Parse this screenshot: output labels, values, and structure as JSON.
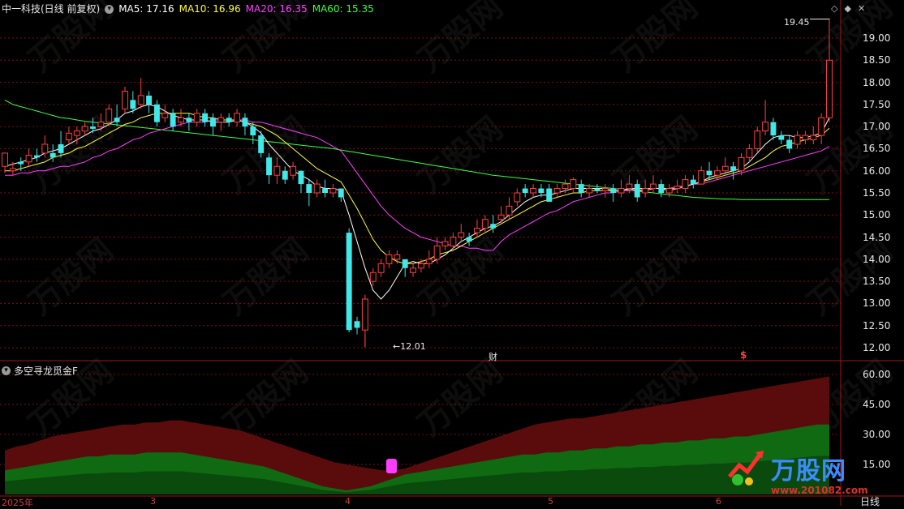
{
  "header": {
    "title": "中一科技(日线 前复权)",
    "ma5_label": "MA5: 17.16",
    "ma10_label": "MA10: 16.96",
    "ma20_label": "MA20: 16.35",
    "ma60_label": "MA60: 15.35"
  },
  "colors": {
    "ma5": "#ffffff",
    "ma10": "#ffff40",
    "ma20": "#ff40ff",
    "ma60": "#40ff40",
    "up": "#ff4040",
    "down": "#40e8e8",
    "grid": "#7a1010",
    "axis_text": "#e8e8e8"
  },
  "price_axis": [
    "19.00",
    "18.50",
    "18.00",
    "17.50",
    "17.00",
    "16.50",
    "16.00",
    "15.50",
    "15.00",
    "14.50",
    "14.00",
    "13.50",
    "13.00",
    "12.50",
    "12.00"
  ],
  "indicator_axis": [
    "60.00",
    "45.00",
    "30.00",
    "15.00"
  ],
  "annotations": {
    "high": "19.45",
    "low": "←12.01",
    "cai": "财",
    "dollar": "$"
  },
  "indicator": {
    "name": "多空寻龙觅金F"
  },
  "time_axis": [
    {
      "label": "2025年"
    },
    {
      "label": "3"
    },
    {
      "label": "4"
    },
    {
      "label": "5"
    },
    {
      "label": "6"
    }
  ],
  "period_label": "日线",
  "brand": {
    "name": "万股网",
    "url": "www.201082.com"
  },
  "window_icons": [
    "diamond-icon",
    "restore-icon",
    "close-icon"
  ],
  "chart_data": {
    "type": "candlestick",
    "ma_values": {
      "MA5": 17.16,
      "MA10": 16.96,
      "MA20": 16.35,
      "MA60": 15.35
    },
    "ylim": [
      11.9,
      19.5
    ],
    "high_marker": 19.45,
    "low_marker": 12.01,
    "candles": [
      [
        16.1,
        16.4,
        16.25,
        15.95
      ],
      [
        16.0,
        16.05,
        16.2,
        15.9
      ],
      [
        16.2,
        16.15,
        16.3,
        16.0
      ],
      [
        16.2,
        16.35,
        16.5,
        16.1
      ],
      [
        16.35,
        16.3,
        16.5,
        16.2
      ],
      [
        16.4,
        16.6,
        16.8,
        16.3
      ],
      [
        16.4,
        16.3,
        16.6,
        16.2
      ],
      [
        16.6,
        16.4,
        16.9,
        16.3
      ],
      [
        16.7,
        16.85,
        17.0,
        16.6
      ],
      [
        16.8,
        16.9,
        17.0,
        16.6
      ],
      [
        16.9,
        17.0,
        17.1,
        16.8
      ],
      [
        17.0,
        16.95,
        17.2,
        16.85
      ],
      [
        17.0,
        17.1,
        17.3,
        16.9
      ],
      [
        17.1,
        17.4,
        17.5,
        17.0
      ],
      [
        17.2,
        17.1,
        17.5,
        17.0
      ],
      [
        17.4,
        17.8,
        17.9,
        17.3
      ],
      [
        17.6,
        17.4,
        17.8,
        17.3
      ],
      [
        17.5,
        17.7,
        18.1,
        17.4
      ],
      [
        17.7,
        17.5,
        17.8,
        17.3
      ],
      [
        17.5,
        17.1,
        17.6,
        17.0
      ],
      [
        17.2,
        17.3,
        17.5,
        17.1
      ],
      [
        17.3,
        17.0,
        17.4,
        16.9
      ],
      [
        17.1,
        17.2,
        17.4,
        17.0
      ],
      [
        17.2,
        17.1,
        17.3,
        16.9
      ],
      [
        17.1,
        17.3,
        17.4,
        17.0
      ],
      [
        17.3,
        17.1,
        17.4,
        17.0
      ],
      [
        17.2,
        17.0,
        17.3,
        16.8
      ],
      [
        17.1,
        17.2,
        17.3,
        16.9
      ],
      [
        17.2,
        17.1,
        17.3,
        17.0
      ],
      [
        17.1,
        17.3,
        17.4,
        17.0
      ],
      [
        17.2,
        17.0,
        17.3,
        16.8
      ],
      [
        17.0,
        16.8,
        17.1,
        16.6
      ],
      [
        16.8,
        16.4,
        16.9,
        16.3
      ],
      [
        16.3,
        15.9,
        16.4,
        15.7
      ],
      [
        15.9,
        16.1,
        16.3,
        15.7
      ],
      [
        16.0,
        15.8,
        16.1,
        15.7
      ],
      [
        15.9,
        16.1,
        16.2,
        15.8
      ],
      [
        16.0,
        15.7,
        16.0,
        15.5
      ],
      [
        15.7,
        15.5,
        15.8,
        15.2
      ],
      [
        15.5,
        15.7,
        15.8,
        15.4
      ],
      [
        15.6,
        15.5,
        15.8,
        15.4
      ],
      [
        15.5,
        15.6,
        15.7,
        15.4
      ],
      [
        15.6,
        15.4,
        15.6,
        15.3
      ],
      [
        14.6,
        12.4,
        14.7,
        12.35
      ],
      [
        12.6,
        12.45,
        12.7,
        12.3
      ],
      [
        12.4,
        13.1,
        13.2,
        12.01
      ],
      [
        13.5,
        13.7,
        13.8,
        13.4
      ],
      [
        13.7,
        13.9,
        14.0,
        13.6
      ],
      [
        13.9,
        14.1,
        14.2,
        13.8
      ],
      [
        14.0,
        14.1,
        14.2,
        13.9
      ],
      [
        14.0,
        13.8,
        14.0,
        13.6
      ],
      [
        13.7,
        13.8,
        13.9,
        13.6
      ],
      [
        13.8,
        13.9,
        14.0,
        13.7
      ],
      [
        13.9,
        14.0,
        14.2,
        13.8
      ],
      [
        14.0,
        14.3,
        14.5,
        13.9
      ],
      [
        14.3,
        14.4,
        14.5,
        14.2
      ],
      [
        14.3,
        14.5,
        14.6,
        14.2
      ],
      [
        14.5,
        14.6,
        14.8,
        14.4
      ],
      [
        14.5,
        14.4,
        14.6,
        14.3
      ],
      [
        14.6,
        14.7,
        14.9,
        14.5
      ],
      [
        14.7,
        14.9,
        15.0,
        14.6
      ],
      [
        14.8,
        14.7,
        15.0,
        14.6
      ],
      [
        14.9,
        15.0,
        15.2,
        14.8
      ],
      [
        15.0,
        15.2,
        15.4,
        14.9
      ],
      [
        15.3,
        15.5,
        15.6,
        15.2
      ],
      [
        15.6,
        15.5,
        15.7,
        15.4
      ],
      [
        15.5,
        15.6,
        15.7,
        15.4
      ],
      [
        15.6,
        15.5,
        15.7,
        15.4
      ],
      [
        15.6,
        15.3,
        15.7,
        15.3
      ],
      [
        15.5,
        15.6,
        15.7,
        15.4
      ],
      [
        15.6,
        15.7,
        15.8,
        15.5
      ],
      [
        15.6,
        15.8,
        15.85,
        15.5
      ],
      [
        15.7,
        15.5,
        15.8,
        15.4
      ],
      [
        15.5,
        15.6,
        15.7,
        15.4
      ],
      [
        15.6,
        15.55,
        15.7,
        15.5
      ],
      [
        15.55,
        15.6,
        15.7,
        15.4
      ],
      [
        15.6,
        15.5,
        15.7,
        15.3
      ],
      [
        15.5,
        15.6,
        15.8,
        15.4
      ],
      [
        15.6,
        15.7,
        15.9,
        15.5
      ],
      [
        15.7,
        15.4,
        15.8,
        15.3
      ],
      [
        15.5,
        15.6,
        15.8,
        15.4
      ],
      [
        15.6,
        15.7,
        15.9,
        15.5
      ],
      [
        15.7,
        15.5,
        15.8,
        15.4
      ],
      [
        15.5,
        15.6,
        15.7,
        15.4
      ],
      [
        15.6,
        15.65,
        15.8,
        15.5
      ],
      [
        15.6,
        15.8,
        15.9,
        15.5
      ],
      [
        15.8,
        15.7,
        15.9,
        15.6
      ],
      [
        15.7,
        16.0,
        16.1,
        15.7
      ],
      [
        16.0,
        15.9,
        16.2,
        15.8
      ],
      [
        15.9,
        16.0,
        16.1,
        15.8
      ],
      [
        16.0,
        16.1,
        16.3,
        15.9
      ],
      [
        16.1,
        16.0,
        16.2,
        15.8
      ],
      [
        16.0,
        16.3,
        16.4,
        15.9
      ],
      [
        16.3,
        16.5,
        16.6,
        16.2
      ],
      [
        16.5,
        16.9,
        17.0,
        16.4
      ],
      [
        16.9,
        17.1,
        17.6,
        16.8
      ],
      [
        17.1,
        16.8,
        17.2,
        16.7
      ],
      [
        16.8,
        16.7,
        16.9,
        16.6
      ],
      [
        16.7,
        16.5,
        16.8,
        16.4
      ],
      [
        16.6,
        16.8,
        16.9,
        16.5
      ],
      [
        16.7,
        16.8,
        16.9,
        16.6
      ],
      [
        16.7,
        16.8,
        17.0,
        16.6
      ],
      [
        16.8,
        17.2,
        17.3,
        16.6
      ],
      [
        17.2,
        18.5,
        19.45,
        17.1
      ]
    ],
    "ma5": [
      16.1,
      16.15,
      16.2,
      16.25,
      16.3,
      16.4,
      16.45,
      16.5,
      16.6,
      16.7,
      16.8,
      16.9,
      16.95,
      17.05,
      17.15,
      17.3,
      17.35,
      17.45,
      17.5,
      17.45,
      17.35,
      17.25,
      17.2,
      17.15,
      17.15,
      17.15,
      17.1,
      17.1,
      17.1,
      17.15,
      17.1,
      17.0,
      16.85,
      16.6,
      16.4,
      16.2,
      16.0,
      15.9,
      15.8,
      15.65,
      15.6,
      15.6,
      15.55,
      15.0,
      14.4,
      13.8,
      13.3,
      13.1,
      13.3,
      13.6,
      13.9,
      13.95,
      13.9,
      13.9,
      14.0,
      14.1,
      14.25,
      14.4,
      14.5,
      14.6,
      14.7,
      14.75,
      14.85,
      15.0,
      15.15,
      15.3,
      15.4,
      15.45,
      15.45,
      15.5,
      15.55,
      15.6,
      15.6,
      15.6,
      15.6,
      15.6,
      15.55,
      15.55,
      15.6,
      15.55,
      15.55,
      15.6,
      15.6,
      15.55,
      15.6,
      15.65,
      15.7,
      15.75,
      15.85,
      15.9,
      15.95,
      16.0,
      16.05,
      16.2,
      16.4,
      16.6,
      16.75,
      16.8,
      16.8,
      16.75,
      16.75,
      16.8,
      16.85,
      17.2
    ],
    "ma10": [
      16.0,
      16.0,
      16.05,
      16.1,
      16.15,
      16.2,
      16.3,
      16.35,
      16.4,
      16.5,
      16.55,
      16.65,
      16.75,
      16.85,
      16.95,
      17.05,
      17.1,
      17.2,
      17.25,
      17.3,
      17.3,
      17.3,
      17.3,
      17.3,
      17.25,
      17.2,
      17.2,
      17.15,
      17.15,
      17.15,
      17.1,
      17.05,
      17.0,
      16.9,
      16.8,
      16.65,
      16.5,
      16.35,
      16.2,
      16.05,
      15.95,
      15.85,
      15.75,
      15.45,
      15.15,
      14.8,
      14.45,
      14.2,
      14.05,
      13.95,
      13.9,
      13.9,
      13.95,
      14.0,
      14.1,
      14.15,
      14.2,
      14.3,
      14.4,
      14.5,
      14.6,
      14.7,
      14.8,
      14.9,
      15.0,
      15.1,
      15.2,
      15.3,
      15.35,
      15.4,
      15.45,
      15.5,
      15.5,
      15.55,
      15.55,
      15.55,
      15.55,
      15.55,
      15.6,
      15.6,
      15.6,
      15.6,
      15.6,
      15.6,
      15.6,
      15.65,
      15.7,
      15.75,
      15.8,
      15.85,
      15.9,
      15.95,
      16.0,
      16.1,
      16.2,
      16.3,
      16.45,
      16.55,
      16.6,
      16.65,
      16.7,
      16.75,
      16.8,
      16.96
    ],
    "ma20": [
      15.9,
      15.9,
      15.95,
      15.95,
      16.0,
      16.0,
      16.05,
      16.1,
      16.1,
      16.15,
      16.2,
      16.3,
      16.35,
      16.45,
      16.5,
      16.6,
      16.7,
      16.75,
      16.85,
      16.9,
      16.95,
      17.0,
      17.05,
      17.1,
      17.1,
      17.1,
      17.15,
      17.15,
      17.15,
      17.15,
      17.15,
      17.1,
      17.1,
      17.05,
      17.0,
      16.95,
      16.9,
      16.85,
      16.8,
      16.75,
      16.65,
      16.55,
      16.45,
      16.2,
      15.95,
      15.7,
      15.45,
      15.2,
      15.0,
      14.85,
      14.7,
      14.6,
      14.5,
      14.45,
      14.4,
      14.35,
      14.3,
      14.3,
      14.25,
      14.25,
      14.2,
      14.2,
      14.4,
      14.55,
      14.65,
      14.75,
      14.85,
      14.95,
      15.05,
      15.1,
      15.2,
      15.3,
      15.35,
      15.4,
      15.45,
      15.5,
      15.5,
      15.55,
      15.55,
      15.55,
      15.6,
      15.6,
      15.6,
      15.6,
      15.65,
      15.65,
      15.7,
      15.7,
      15.75,
      15.8,
      15.85,
      15.9,
      15.95,
      16.0,
      16.05,
      16.1,
      16.15,
      16.2,
      16.25,
      16.3,
      16.35,
      16.4,
      16.45,
      16.55
    ],
    "ma60": [
      17.6,
      17.5,
      17.45,
      17.4,
      17.35,
      17.3,
      17.25,
      17.2,
      17.18,
      17.15,
      17.12,
      17.1,
      17.08,
      17.06,
      17.04,
      17.02,
      17.0,
      16.98,
      16.96,
      16.94,
      16.92,
      16.9,
      16.88,
      16.86,
      16.84,
      16.82,
      16.8,
      16.78,
      16.76,
      16.74,
      16.72,
      16.7,
      16.68,
      16.66,
      16.64,
      16.62,
      16.6,
      16.58,
      16.56,
      16.54,
      16.52,
      16.5,
      16.47,
      16.44,
      16.41,
      16.38,
      16.35,
      16.32,
      16.29,
      16.26,
      16.23,
      16.2,
      16.17,
      16.14,
      16.11,
      16.08,
      16.05,
      16.02,
      15.99,
      15.96,
      15.93,
      15.9,
      15.88,
      15.86,
      15.84,
      15.82,
      15.8,
      15.78,
      15.76,
      15.74,
      15.72,
      15.7,
      15.68,
      15.66,
      15.64,
      15.62,
      15.6,
      15.58,
      15.56,
      15.54,
      15.52,
      15.5,
      15.48,
      15.46,
      15.44,
      15.42,
      15.4,
      15.39,
      15.38,
      15.37,
      15.36,
      15.36,
      15.35,
      15.35,
      15.35,
      15.35,
      15.35,
      15.35,
      15.35,
      15.35,
      15.35,
      15.35,
      15.35,
      15.35
    ],
    "indicator_band_outer": [
      22,
      24,
      25,
      27,
      29,
      30,
      31,
      32,
      33,
      34,
      35,
      35,
      36,
      36,
      37,
      37,
      36,
      35,
      34,
      33,
      32,
      30,
      28,
      26,
      24,
      22,
      20,
      18,
      16,
      15,
      14,
      13,
      12,
      12,
      13,
      15,
      17,
      19,
      21,
      23,
      25,
      27,
      29,
      31,
      33,
      35,
      36,
      37,
      38,
      38,
      39,
      40,
      41,
      42,
      43,
      44,
      45,
      46,
      47,
      48,
      49,
      50,
      51,
      52,
      53,
      54,
      55,
      56,
      57,
      58,
      59
    ],
    "indicator_band_inner": [
      12,
      13,
      14,
      15,
      16,
      17,
      18,
      19,
      19,
      20,
      20,
      20,
      21,
      21,
      21,
      21,
      20,
      19,
      18,
      17,
      16,
      15,
      14,
      12,
      10,
      8,
      6,
      4,
      3,
      2,
      3,
      4,
      6,
      8,
      10,
      11,
      12,
      13,
      14,
      15,
      16,
      17,
      18,
      19,
      20,
      20,
      21,
      21,
      22,
      22,
      23,
      23,
      24,
      24,
      25,
      25,
      26,
      26,
      27,
      27,
      28,
      28,
      29,
      29,
      30,
      31,
      32,
      33,
      34,
      35,
      35
    ]
  }
}
